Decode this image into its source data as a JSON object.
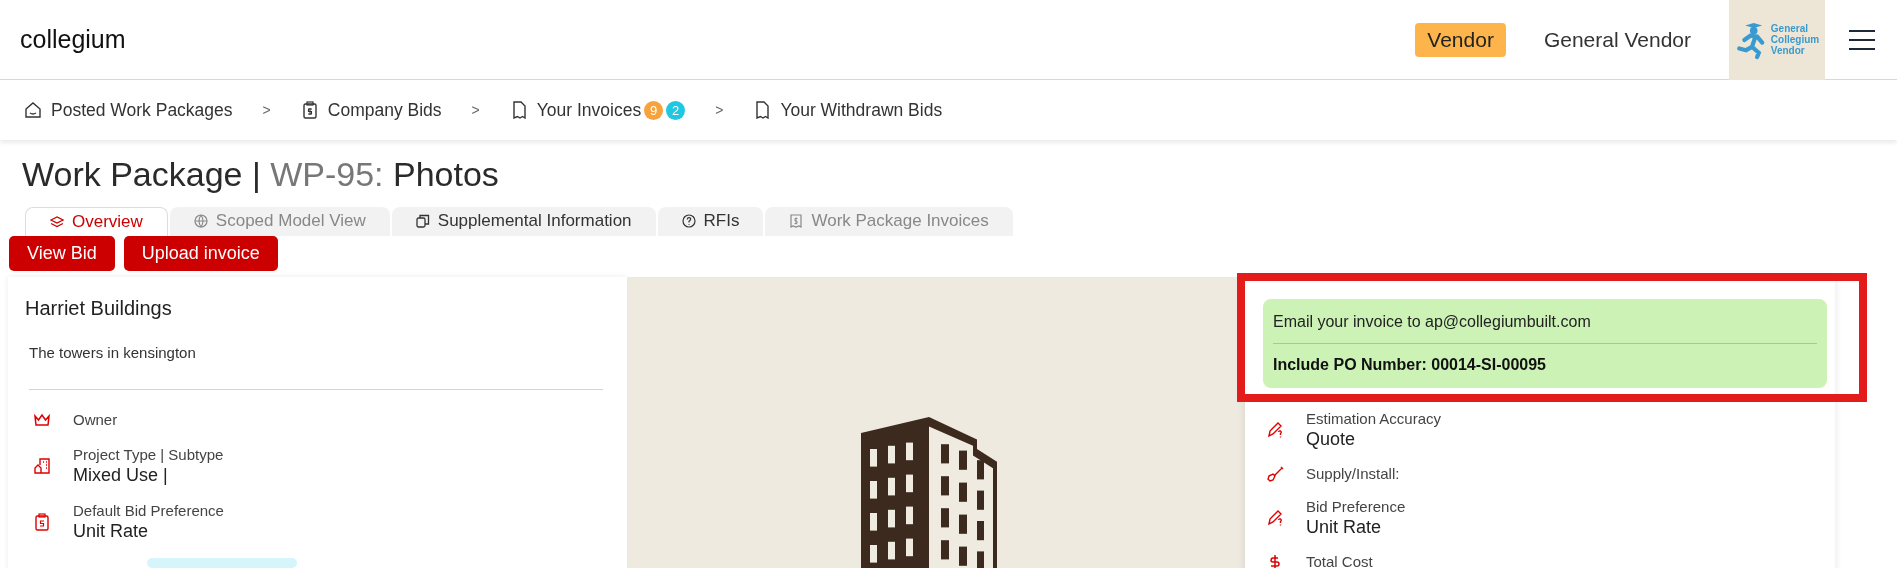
{
  "header": {
    "logo": "collegium",
    "role_badge": "Vendor",
    "user_name": "General Vendor",
    "company_logo": {
      "lines": [
        "General",
        "Collegium",
        "Vendor"
      ]
    }
  },
  "breadcrumbs": [
    {
      "label": "Posted Work Packages",
      "kind": "home"
    },
    {
      "separator": ">",
      "label": "Company Bids",
      "kind": "bids"
    },
    {
      "separator": ">",
      "label": "Your Invoices",
      "kind": "document",
      "badges": [
        {
          "count": "9",
          "color": "#f7a23b"
        },
        {
          "count": "2",
          "color": "#1ec8e0"
        }
      ]
    },
    {
      "separator": ">",
      "label": "Your Withdrawn Bids",
      "kind": "document"
    }
  ],
  "page_title": {
    "prefix": "Work Package |",
    "code": "WP-95:",
    "name": "Photos"
  },
  "tabs": [
    {
      "label": "Overview",
      "kind": "overview",
      "selected": true,
      "disabled": false
    },
    {
      "label": "Scoped Model View",
      "kind": "model",
      "selected": false,
      "disabled": true
    },
    {
      "label": "Supplemental Information",
      "kind": "supplemental",
      "selected": false,
      "disabled": false
    },
    {
      "label": "RFIs",
      "kind": "rfi",
      "selected": false,
      "disabled": false
    },
    {
      "label": "Work Package Invoices",
      "kind": "invoices",
      "selected": false,
      "disabled": true
    }
  ],
  "actions": [
    "View Bid",
    "Upload invoice"
  ],
  "project": {
    "name": "Harriet Buildings",
    "description": "The towers in kensington",
    "fields": [
      {
        "kind": "owner",
        "label": "Owner"
      },
      {
        "kind": "type",
        "label": "Project Type | Subtype",
        "value": "Mixed Use |"
      },
      {
        "kind": "preference",
        "label": "Default Bid Preference",
        "value": "Unit Rate"
      }
    ]
  },
  "invoice_notice": {
    "email_line": "Email your invoice to ap@collegiumbuilt.com",
    "po_line": "Include PO Number: 00014-SI-00095",
    "highlighted": true
  },
  "bid_details": [
    {
      "kind": "estimate",
      "label": "Estimation Accuracy",
      "value": "Quote"
    },
    {
      "kind": "supply",
      "label": "Supply/Install:"
    },
    {
      "kind": "estimate",
      "label": "Bid Preference",
      "value": "Unit Rate"
    },
    {
      "kind": "cost",
      "label": "Total Cost"
    }
  ]
}
